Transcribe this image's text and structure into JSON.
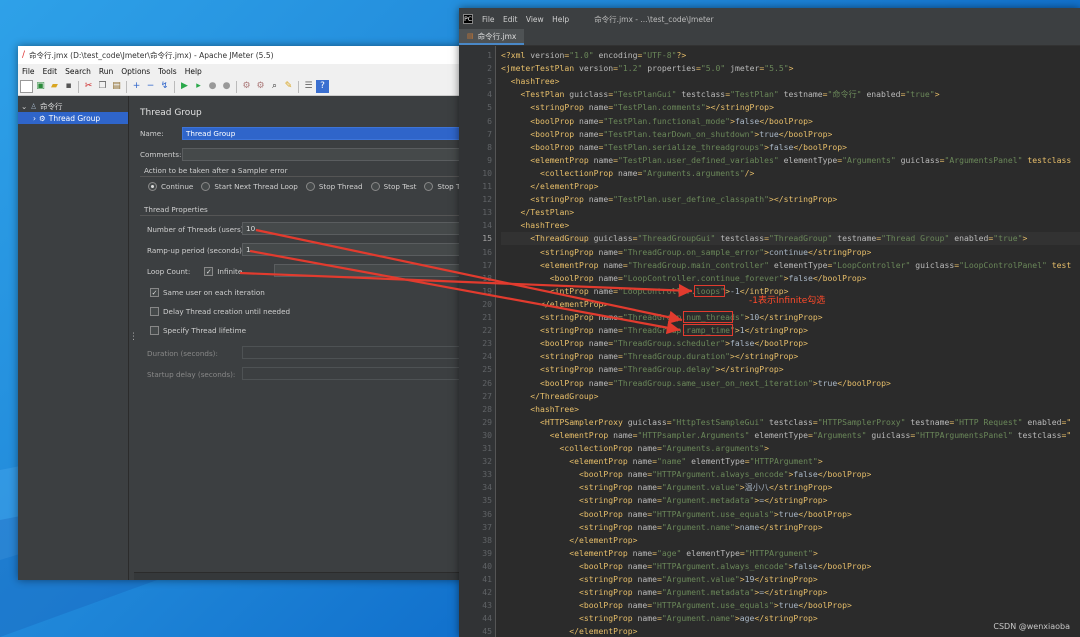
{
  "jmeter": {
    "window_title": "命令行.jmx (D:\\test_code\\Jmeter\\命令行.jmx) - Apache JMeter (5.5)",
    "menu": [
      "File",
      "Edit",
      "Search",
      "Run",
      "Options",
      "Tools",
      "Help"
    ],
    "tree": {
      "root": "命令行",
      "child": "Thread Group"
    },
    "panel": {
      "title": "Thread Group",
      "name_label": "Name:",
      "name_value": "Thread Group",
      "comments_label": "Comments:",
      "comments_value": "",
      "error_action_label": "Action to be taken after a Sampler error",
      "error_actions": [
        "Continue",
        "Start Next Thread Loop",
        "Stop Thread",
        "Stop Test",
        "Stop Test Now"
      ],
      "properties_label": "Thread Properties",
      "threads_label": "Number of Threads (users):",
      "threads_value": "10",
      "rampup_label": "Ramp-up period (seconds):",
      "rampup_value": "1",
      "loop_label": "Loop Count:",
      "infinite_label": "Infinite",
      "same_user_label": "Same user on each iteration",
      "delay_label": "Delay Thread creation until needed",
      "lifetime_label": "Specify Thread lifetime",
      "duration_label": "Duration (seconds):",
      "startup_label": "Startup delay (seconds):"
    }
  },
  "editor": {
    "title_file": "命令行.jmx - ...\\test_code\\Jmeter",
    "menu": [
      "File",
      "Edit",
      "View",
      "Help"
    ],
    "tab_label": "命令行.jmx",
    "annotation": "-1表示Infinite勾选",
    "watermark": "CSDN @wenxiaoba",
    "current_line": 15,
    "lines": [
      "<?xml version=\"1.0\" encoding=\"UTF-8\"?>",
      "<jmeterTestPlan version=\"1.2\" properties=\"5.0\" jmeter=\"5.5\">",
      "  <hashTree>",
      "    <TestPlan guiclass=\"TestPlanGui\" testclass=\"TestPlan\" testname=\"命令行\" enabled=\"true\">",
      "      <stringProp name=\"TestPlan.comments\"></stringProp>",
      "      <boolProp name=\"TestPlan.functional_mode\">false</boolProp>",
      "      <boolProp name=\"TestPlan.tearDown_on_shutdown\">true</boolProp>",
      "      <boolProp name=\"TestPlan.serialize_threadgroups\">false</boolProp>",
      "      <elementProp name=\"TestPlan.user_defined_variables\" elementType=\"Arguments\" guiclass=\"ArgumentsPanel\" testclass",
      "        <collectionProp name=\"Arguments.arguments\"/>",
      "      </elementProp>",
      "      <stringProp name=\"TestPlan.user_define_classpath\"></stringProp>",
      "    </TestPlan>",
      "    <hashTree>",
      "      <ThreadGroup guiclass=\"ThreadGroupGui\" testclass=\"ThreadGroup\" testname=\"Thread Group\" enabled=\"true\">",
      "        <stringProp name=\"ThreadGroup.on_sample_error\">continue</stringProp>",
      "        <elementProp name=\"ThreadGroup.main_controller\" elementType=\"LoopController\" guiclass=\"LoopControlPanel\" test",
      "          <boolProp name=\"LoopController.continue_forever\">false</boolProp>",
      "          <intProp name=\"LoopController.loops\">-1</intProp>",
      "        </elementProp>",
      "        <stringProp name=\"ThreadGroup.num_threads\">10</stringProp>",
      "        <stringProp name=\"ThreadGroup.ramp_time\">1</stringProp>",
      "        <boolProp name=\"ThreadGroup.scheduler\">false</boolProp>",
      "        <stringProp name=\"ThreadGroup.duration\"></stringProp>",
      "        <stringProp name=\"ThreadGroup.delay\"></stringProp>",
      "        <boolProp name=\"ThreadGroup.same_user_on_next_iteration\">true</boolProp>",
      "      </ThreadGroup>",
      "      <hashTree>",
      "        <HTTPSamplerProxy guiclass=\"HttpTestSampleGui\" testclass=\"HTTPSamplerProxy\" testname=\"HTTP Request\" enabled=\"",
      "          <elementProp name=\"HTTPsampler.Arguments\" elementType=\"Arguments\" guiclass=\"HTTPArgumentsPanel\" testclass=\"",
      "            <collectionProp name=\"Arguments.arguments\">",
      "              <elementProp name=\"name\" elementType=\"HTTPArgument\">",
      "                <boolProp name=\"HTTPArgument.always_encode\">false</boolProp>",
      "                <stringProp name=\"Argument.value\">温小八</stringProp>",
      "                <stringProp name=\"Argument.metadata\">=</stringProp>",
      "                <boolProp name=\"HTTPArgument.use_equals\">true</boolProp>",
      "                <stringProp name=\"Argument.name\">name</stringProp>",
      "              </elementProp>",
      "              <elementProp name=\"age\" elementType=\"HTTPArgument\">",
      "                <boolProp name=\"HTTPArgument.always_encode\">false</boolProp>",
      "                <stringProp name=\"Argument.value\">19</stringProp>",
      "                <stringProp name=\"Argument.metadata\">=</stringProp>",
      "                <boolProp name=\"HTTPArgument.use_equals\">true</boolProp>",
      "                <stringProp name=\"Argument.name\">age</stringProp>",
      "              </elementProp>"
    ]
  },
  "colors": {
    "annotation_red": "#e23b2e",
    "xml_tag": "#e8bf6a",
    "xml_value": "#6a8759",
    "selection_blue": "#2f65ca"
  }
}
